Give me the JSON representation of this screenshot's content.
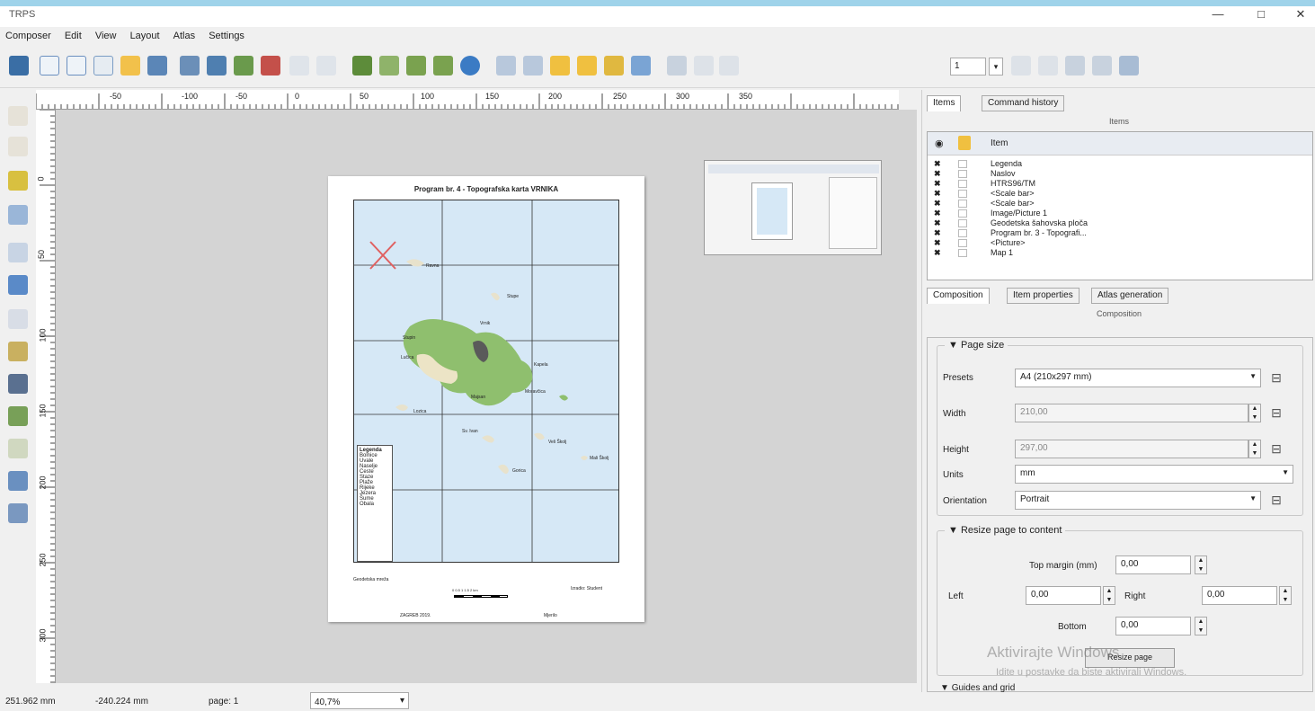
{
  "window": {
    "title": "TRPS",
    "minimize": "—",
    "maximize": "□",
    "close": "✕"
  },
  "menu": [
    "Composer",
    "Edit",
    "View",
    "Layout",
    "Atlas",
    "Settings"
  ],
  "toolbar": {
    "page_value": "1",
    "page_dropdown": "▾"
  },
  "ruler": {
    "h_labels": [
      "-50",
      "-100",
      "-50",
      "0",
      "50",
      "100",
      "150",
      "200",
      "250",
      "300",
      "350"
    ],
    "v_labels": [
      "0",
      "50",
      "100",
      "150",
      "200",
      "250",
      "300"
    ]
  },
  "paper": {
    "title": "Program br. 4 - Topografska karta VRNIKA",
    "legend_title": "Legenda",
    "legend_items": [
      "Bolnice",
      "Uvale",
      "Naselje",
      "Ceste",
      "Staze",
      "Plaže",
      "Rijeke",
      "Jezera",
      "Šume",
      "Obala"
    ],
    "place_labels": [
      "Ravna",
      "Stupe",
      "Vrnik",
      "Kapela",
      "Lučica",
      "Stupin",
      "Moravčica",
      "Lozica",
      "Sv. Ivan",
      "Mali Školj",
      "Veli Školj",
      "Gorica",
      "Majsan"
    ],
    "footer_left": "Geodetska mreža",
    "footer_right": "Izradio: Student",
    "scale_caption": "0   0.5   1   1.5   2 km",
    "bottom_left": "ZAGREB 2019.",
    "bottom_right": "Mjerilo"
  },
  "right_panel": {
    "tabs": [
      "Items",
      "Command history"
    ],
    "items_header": "Items",
    "items_col": "Item",
    "items": [
      "Legenda",
      "Naslov",
      "HTRS96/TM",
      "<Scale bar>",
      "<Scale bar>",
      "Image/Picture 1",
      "Geodetska šahovska ploča",
      "Program br. 3 - Topografi...",
      "<Picture>",
      "Map 1"
    ],
    "prop_tabs": [
      "Composition",
      "Item properties",
      "Atlas generation"
    ],
    "prop_header": "Composition",
    "page_size": {
      "title": "Page size",
      "presets_label": "Presets",
      "presets_value": "A4 (210x297 mm)",
      "width_label": "Width",
      "width_value": "210,00",
      "height_label": "Height",
      "height_value": "297,00",
      "units_label": "Units",
      "units_value": "mm",
      "orientation_label": "Orientation",
      "orientation_value": "Portrait"
    },
    "resize": {
      "title": "Resize page to content",
      "top_label": "Top margin (mm)",
      "top_value": "0,00",
      "left_label": "Left",
      "left_value": "0,00",
      "right_label": "Right",
      "right_value": "0,00",
      "bottom_label": "Bottom",
      "bottom_value": "0,00",
      "button": "Resize page"
    },
    "next_group": "Guides and grid"
  },
  "watermark": {
    "line1": "Aktivirajte Windows",
    "line2": "Idite u postavke da biste aktivirali Windows."
  },
  "status": {
    "x": "251.962 mm",
    "y": "-240.224 mm",
    "page": "page: 1",
    "zoom": "40,7%",
    "zoom_dropdown": "▾"
  }
}
